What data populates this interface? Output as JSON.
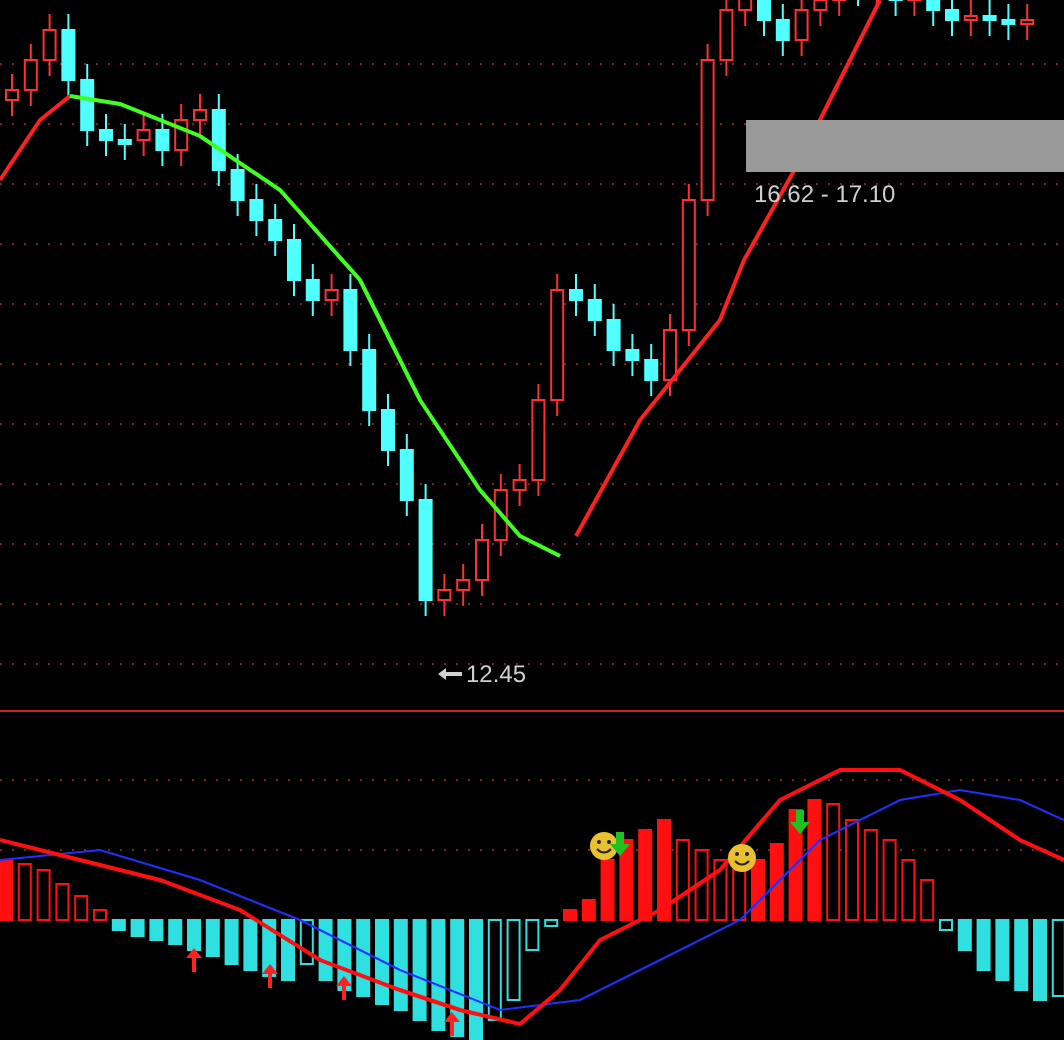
{
  "price_panel": {
    "range_label": "16.62 - 17.10",
    "low_label": "12.45"
  }
}
